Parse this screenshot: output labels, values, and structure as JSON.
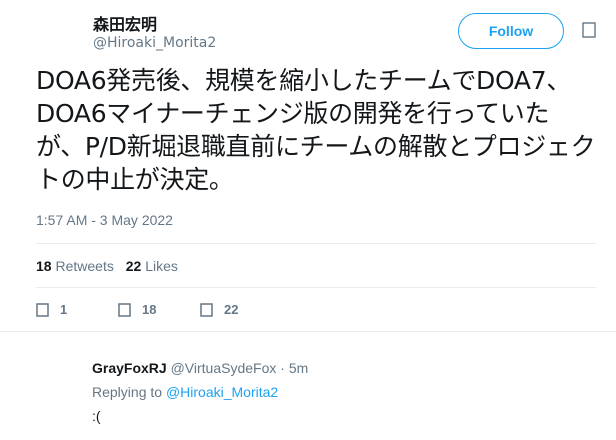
{
  "tweet": {
    "author_name": "森田宏明",
    "author_handle": "@Hiroaki_Morita2",
    "follow_label": "Follow",
    "text": "DOA6発売後、規模を縮小したチームでDOA7、DOA6マイナーチェンジ版の開発を行っていたが、P/D新堀退職直前にチームの解散とプロジェクトの中止が決定。",
    "timestamp": "1:57 AM - 3 May 2022",
    "retweets_count": "18",
    "retweets_label": "Retweets",
    "likes_count": "22",
    "likes_label": "Likes",
    "actions": {
      "reply_count": "1",
      "retweet_count": "18",
      "like_count": "22"
    }
  },
  "reply": {
    "author_name": "GrayFoxRJ",
    "author_handle": "@VirtuaSydeFox",
    "separator": "·",
    "time": "5m",
    "replying_to_label": "Replying to",
    "replying_to_handle": "@Hiroaki_Morita2",
    "text": ":("
  },
  "colors": {
    "accent": "#1da1f2",
    "muted": "#657786",
    "text": "#14171a",
    "divider": "#e6ecf0"
  }
}
